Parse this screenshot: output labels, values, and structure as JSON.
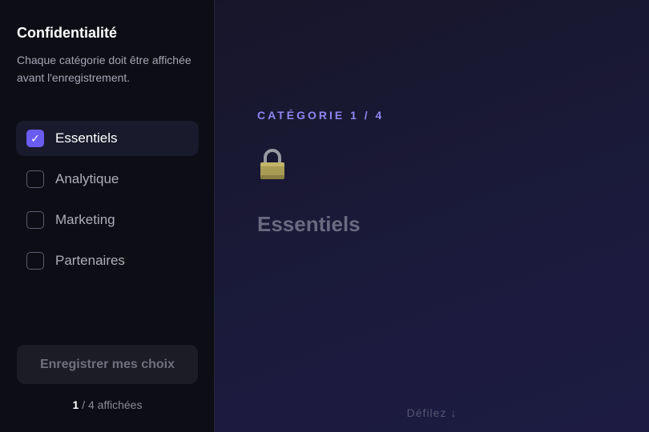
{
  "sidebar": {
    "title": "Confidentialité",
    "description": "Chaque catégorie doit être affichée avant l'enregistrement.",
    "categories": [
      {
        "label": "Essentiels",
        "checked": true
      },
      {
        "label": "Analytique",
        "checked": false
      },
      {
        "label": "Marketing",
        "checked": false
      },
      {
        "label": "Partenaires",
        "checked": false
      }
    ],
    "save_label": "Enregistrer mes choix",
    "counter_current": "1",
    "counter_rest": " / 4 affichées"
  },
  "main": {
    "kicker": "CATÉGORIE 1 / 4",
    "icon": "lock-icon",
    "heading": "Essentiels",
    "scroll_hint": "Défilez ↓"
  },
  "colors": {
    "accent": "#6b5cf0",
    "sidebar_bg": "#0d0d16",
    "main_bg": "#1b1a3c"
  }
}
